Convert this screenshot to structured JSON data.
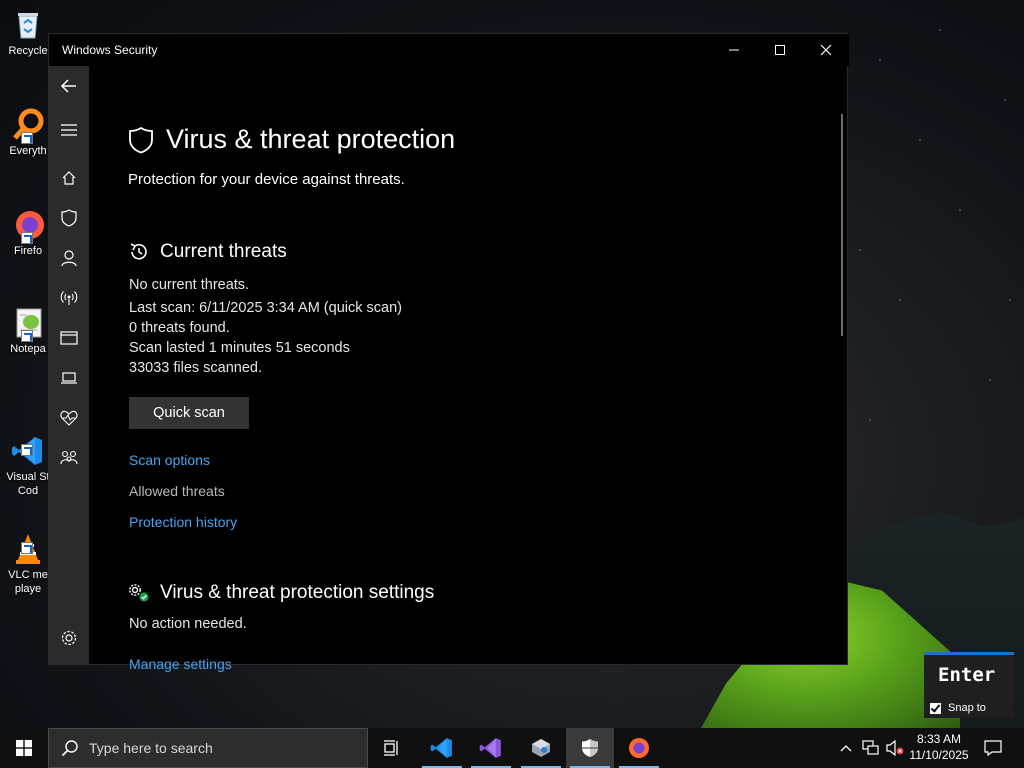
{
  "desktop": {
    "icons": [
      {
        "label": "Recycle"
      },
      {
        "label": "Everyth"
      },
      {
        "label": "Firefo"
      },
      {
        "label": "Notepa"
      },
      {
        "label": "Visual St\nCod"
      },
      {
        "label": "VLC me\nplaye"
      }
    ]
  },
  "window": {
    "title": "Windows Security",
    "minimize_label": "—",
    "maximize_label": "☐",
    "close_label": "✕"
  },
  "page": {
    "heading": "Virus & threat protection",
    "subtitle": "Protection for your device against threats."
  },
  "current_threats": {
    "title": "Current threats",
    "lines": [
      "No current threats.",
      "Last scan: 6/11/2025 3:34 AM (quick scan)",
      "0 threats found.",
      "Scan lasted 1 minutes 51 seconds",
      "33033 files scanned."
    ],
    "quick_scan_label": "Quick scan",
    "scan_options_label": "Scan options",
    "allowed_threats_label": "Allowed threats",
    "protection_history_label": "Protection history"
  },
  "settings": {
    "title": "Virus & threat protection settings",
    "status": "No action needed.",
    "manage_label": "Manage settings"
  },
  "overlay": {
    "key_label": "Enter",
    "snap_label": "Snap to"
  },
  "taskbar": {
    "search_placeholder": "Type here to search",
    "time": "8:33 AM",
    "date": "11/10/2025"
  },
  "colors": {
    "accent_link": "#4aa3f0",
    "taskbar_active": "#76b9ed",
    "tent_green": "#8cd42a"
  }
}
